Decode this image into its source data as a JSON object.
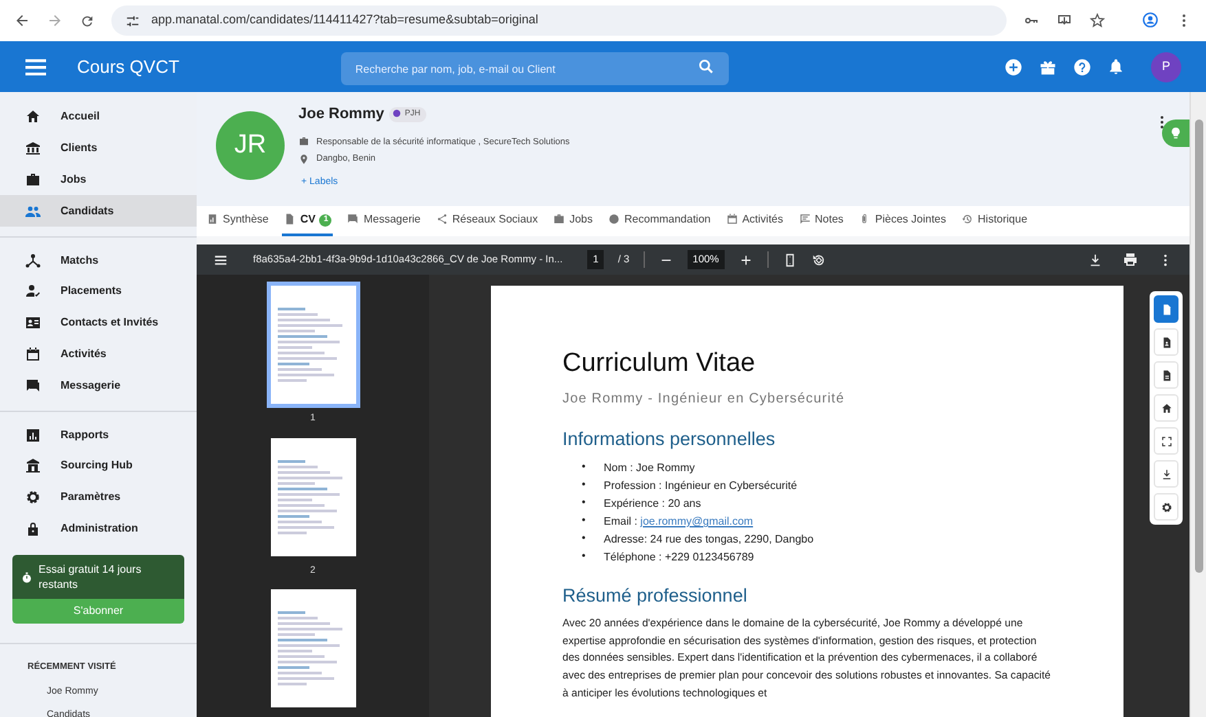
{
  "browser": {
    "url": "app.manatal.com/candidates/114411427?tab=resume&subtab=original"
  },
  "header": {
    "title": "Cours QVCT",
    "search": {
      "placeholder": "Recherche par nom, job, e-mail ou Client"
    },
    "avatar": "P"
  },
  "sidebar": {
    "groups": [
      {
        "items": [
          {
            "label": "Accueil",
            "selected": false
          },
          {
            "label": "Clients",
            "selected": false
          },
          {
            "label": "Jobs",
            "selected": false
          },
          {
            "label": "Candidats",
            "selected": true
          }
        ]
      },
      {
        "items": [
          {
            "label": "Matchs",
            "selected": false
          },
          {
            "label": "Placements",
            "selected": false
          },
          {
            "label": "Contacts et Invités",
            "selected": false
          },
          {
            "label": "Activités",
            "selected": false
          },
          {
            "label": "Messagerie",
            "selected": false
          }
        ]
      },
      {
        "items": [
          {
            "label": "Rapports",
            "selected": false
          },
          {
            "label": "Sourcing Hub",
            "selected": false
          },
          {
            "label": "Paramètres",
            "selected": false
          },
          {
            "label": "Administration",
            "selected": false
          }
        ]
      }
    ],
    "trial": {
      "text": "Essai gratuit 14 jours restants",
      "button": "S'abonner"
    },
    "recent": {
      "heading": "RÉCEMMENT VISITÉ",
      "items": [
        "Joe Rommy",
        "Candidats"
      ]
    }
  },
  "profile": {
    "initials": "JR",
    "name": "Joe Rommy",
    "badge": "PJH",
    "position": "Responsable de la sécurité informatique , SecureTech Solutions",
    "location": "Dangbo, Benin",
    "labels_link": "+ Labels"
  },
  "tabs": [
    {
      "label": "Synthèse",
      "selected": false
    },
    {
      "label": "CV",
      "selected": true,
      "count": "1"
    },
    {
      "label": "Messagerie",
      "selected": false
    },
    {
      "label": "Réseaux Sociaux",
      "selected": false
    },
    {
      "label": "Jobs",
      "selected": false
    },
    {
      "label": "Recommandation",
      "selected": false
    },
    {
      "label": "Activités",
      "selected": false
    },
    {
      "label": "Notes",
      "selected": false
    },
    {
      "label": "Pièces Jointes",
      "selected": false
    },
    {
      "label": "Historique",
      "selected": false
    }
  ],
  "viewer": {
    "filename": "f8a635a4-2bb1-4f3a-9b9d-1d10a43c2866_CV de Joe Rommy - In...",
    "page": "1",
    "page_total": "/ 3",
    "zoom": "100%",
    "thumbnails": [
      {
        "label": "1",
        "selected": true
      },
      {
        "label": "2",
        "selected": false
      },
      {
        "selected": false
      }
    ]
  },
  "document": {
    "title": "Curriculum Vitae",
    "subtitle": "Joe Rommy - Ingénieur en Cybersécurité",
    "sections": [
      {
        "heading": "Informations personnelles",
        "marker": "•",
        "bullets": [
          {
            "text": "Nom : Joe Rommy"
          },
          {
            "text": "Profession : Ingénieur en Cybersécurité"
          },
          {
            "text": "Expérience : 20 ans"
          },
          {
            "text": "Email : ",
            "link": "joe.rommy@gmail.com"
          },
          {
            "text": "Adresse: 24 rue des tongas, 2290, Dangbo"
          },
          {
            "text": "Téléphone : +229 0123456789"
          }
        ]
      },
      {
        "heading": "Résumé professionnel",
        "paragraph": "Avec 20 années d'expérience dans le domaine de la cybersécurité, Joe Rommy a développé une expertise approfondie en sécurisation des systèmes d'information, gestion des risques, et protection des données sensibles. Expert dans l'identification et la prévention des cybermenaces, il a collaboré avec des entreprises de premier plan pour concevoir des solutions robustes et innovantes. Sa capacité à anticiper les évolutions technologiques et"
      }
    ]
  },
  "side_toolbar": [
    {
      "selected": true
    },
    {
      "selected": false
    },
    {
      "selected": false
    },
    {
      "selected": false
    },
    {
      "selected": false
    },
    {
      "selected": false
    },
    {
      "selected": false
    }
  ]
}
